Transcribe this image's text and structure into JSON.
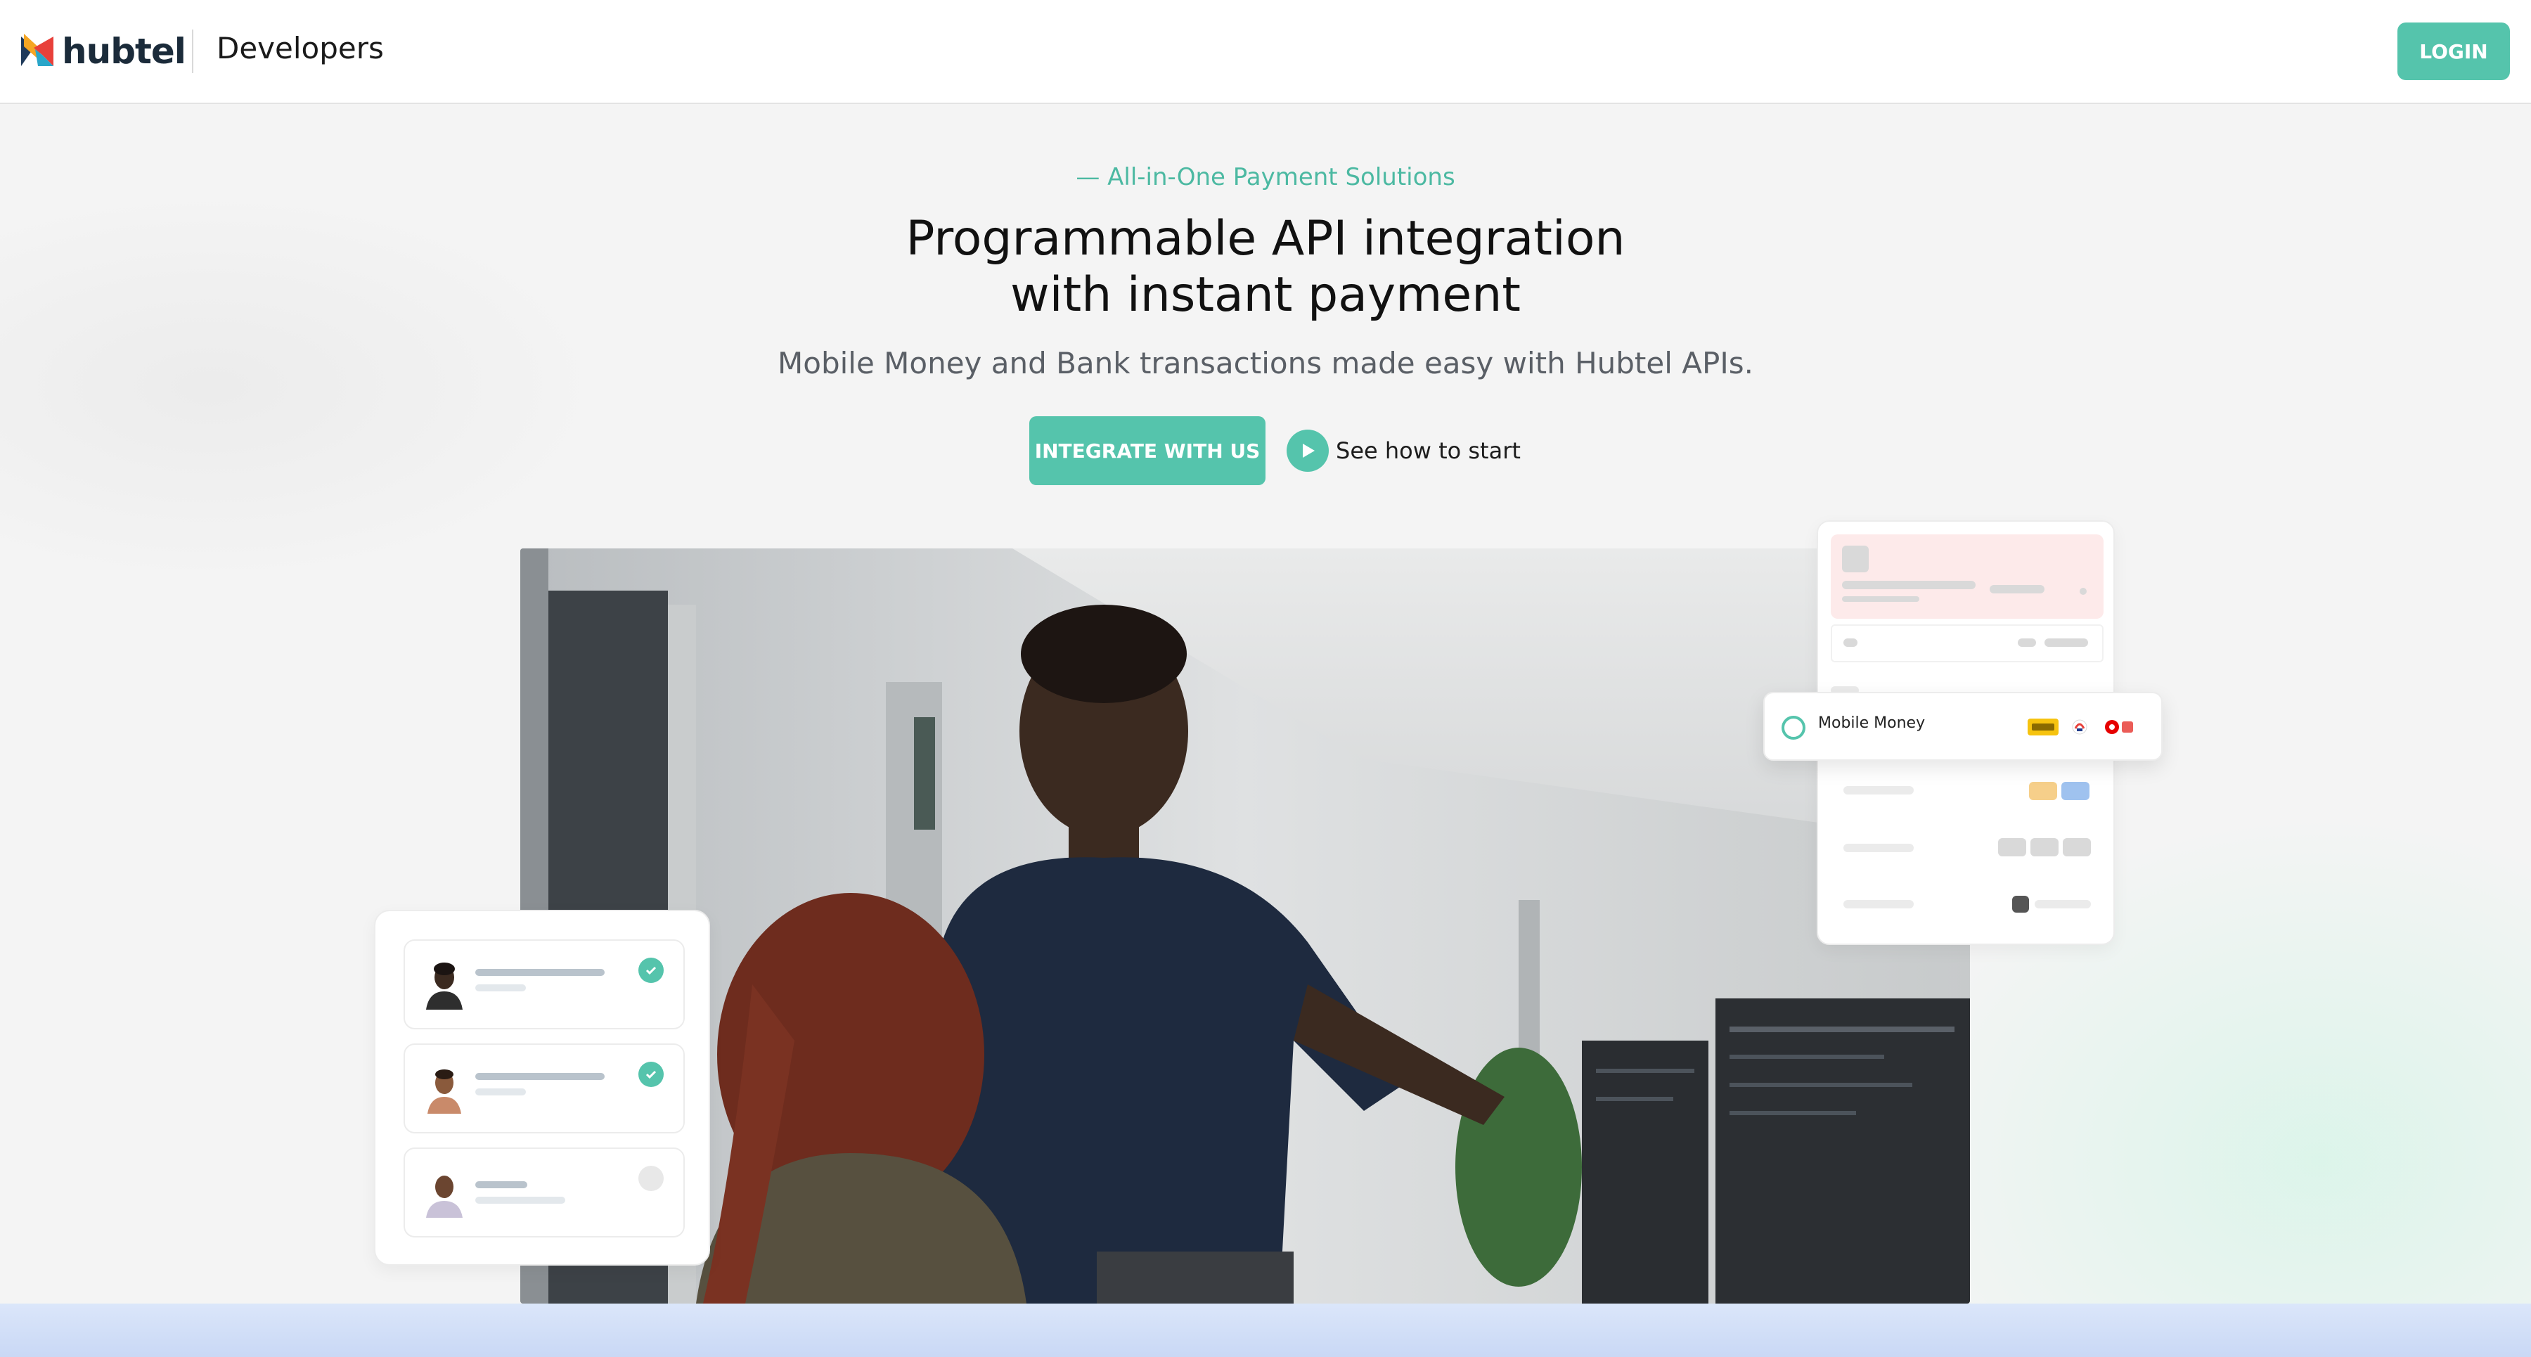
{
  "header": {
    "logo_text": "hubtel",
    "section_label": "Developers",
    "login_label": "LOGIN"
  },
  "hero": {
    "eyebrow": "— All-in-One Payment Solutions",
    "headline_line1": "Programmable API integration",
    "headline_line2": "with instant payment",
    "subline": "Mobile Money and Bank transactions made easy with Hubtel APIs.",
    "primary_cta": "INTEGRATE WITH US",
    "secondary_cta": "See how to start"
  },
  "payment_card": {
    "selected_method_label": "Mobile Money",
    "providers": [
      "mtn-icon",
      "airteltigo-icon",
      "vodafone-icon"
    ]
  },
  "verified_users": [
    {
      "status": "verified"
    },
    {
      "status": "verified"
    },
    {
      "status": "pending"
    }
  ],
  "colors": {
    "accent": "#55c4ac",
    "text_dark": "#111111",
    "text_muted": "#5a5f66",
    "bottom_strip": "#c9d8f5"
  }
}
